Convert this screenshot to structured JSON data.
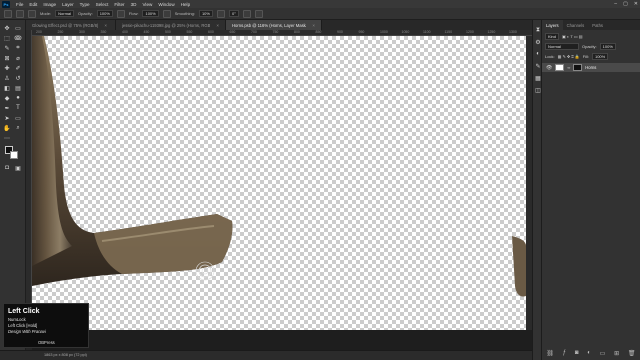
{
  "menubar": {
    "logo": "Ps",
    "items": [
      "File",
      "Edit",
      "Image",
      "Layer",
      "Type",
      "Select",
      "Filter",
      "3D",
      "View",
      "Window",
      "Help"
    ],
    "window_controls": [
      "–",
      "▢",
      "✕"
    ]
  },
  "options": {
    "mode_label": "Mode:",
    "mode_value": "Normal",
    "opacity_label": "Opacity:",
    "opacity_value": "100%",
    "flow_label": "Flow:",
    "flow_value": "100%",
    "smoothing_label": "Smoothing:",
    "smoothing_value": "10%",
    "angle_value": "0°"
  },
  "tabs": [
    {
      "label": "Glowing Effect.psd @ 75% (RGB/8)"
    },
    {
      "label": "jessie-pikachu-119398.jpg @ 25% (Horns, RGB/8)"
    },
    {
      "label": "Horns.psb @ 116% (Horns, Layer Mask/8)"
    }
  ],
  "ruler": {
    "h_ticks": [
      "200",
      "250",
      "300",
      "350",
      "400",
      "450",
      "500",
      "550",
      "600",
      "650",
      "700",
      "750",
      "800",
      "850",
      "900",
      "950",
      "1000",
      "1050",
      "1100",
      "1150",
      "1200",
      "1250",
      "1300"
    ]
  },
  "status": {
    "text": "1863 px x 808 px (72 ppi)"
  },
  "panel": {
    "tabs": [
      "Layers",
      "Channels",
      "Paths"
    ],
    "kind_label": "Kind",
    "blend_value": "Normal",
    "opacity_label": "Opacity:",
    "opacity_value": "100%",
    "lock_label": "Lock:",
    "fill_label": "Fill:",
    "fill_value": "100%",
    "layer_name": "Horns"
  },
  "overlay": {
    "title": "Left Click",
    "lines": [
      "NumLock",
      "Left Click [Hold]",
      "Design With Pranavi"
    ],
    "brand": "OBPress"
  },
  "colors": {
    "accent": "#31a8ff",
    "background": "#262626",
    "canvas_checker": "#cccccc"
  }
}
